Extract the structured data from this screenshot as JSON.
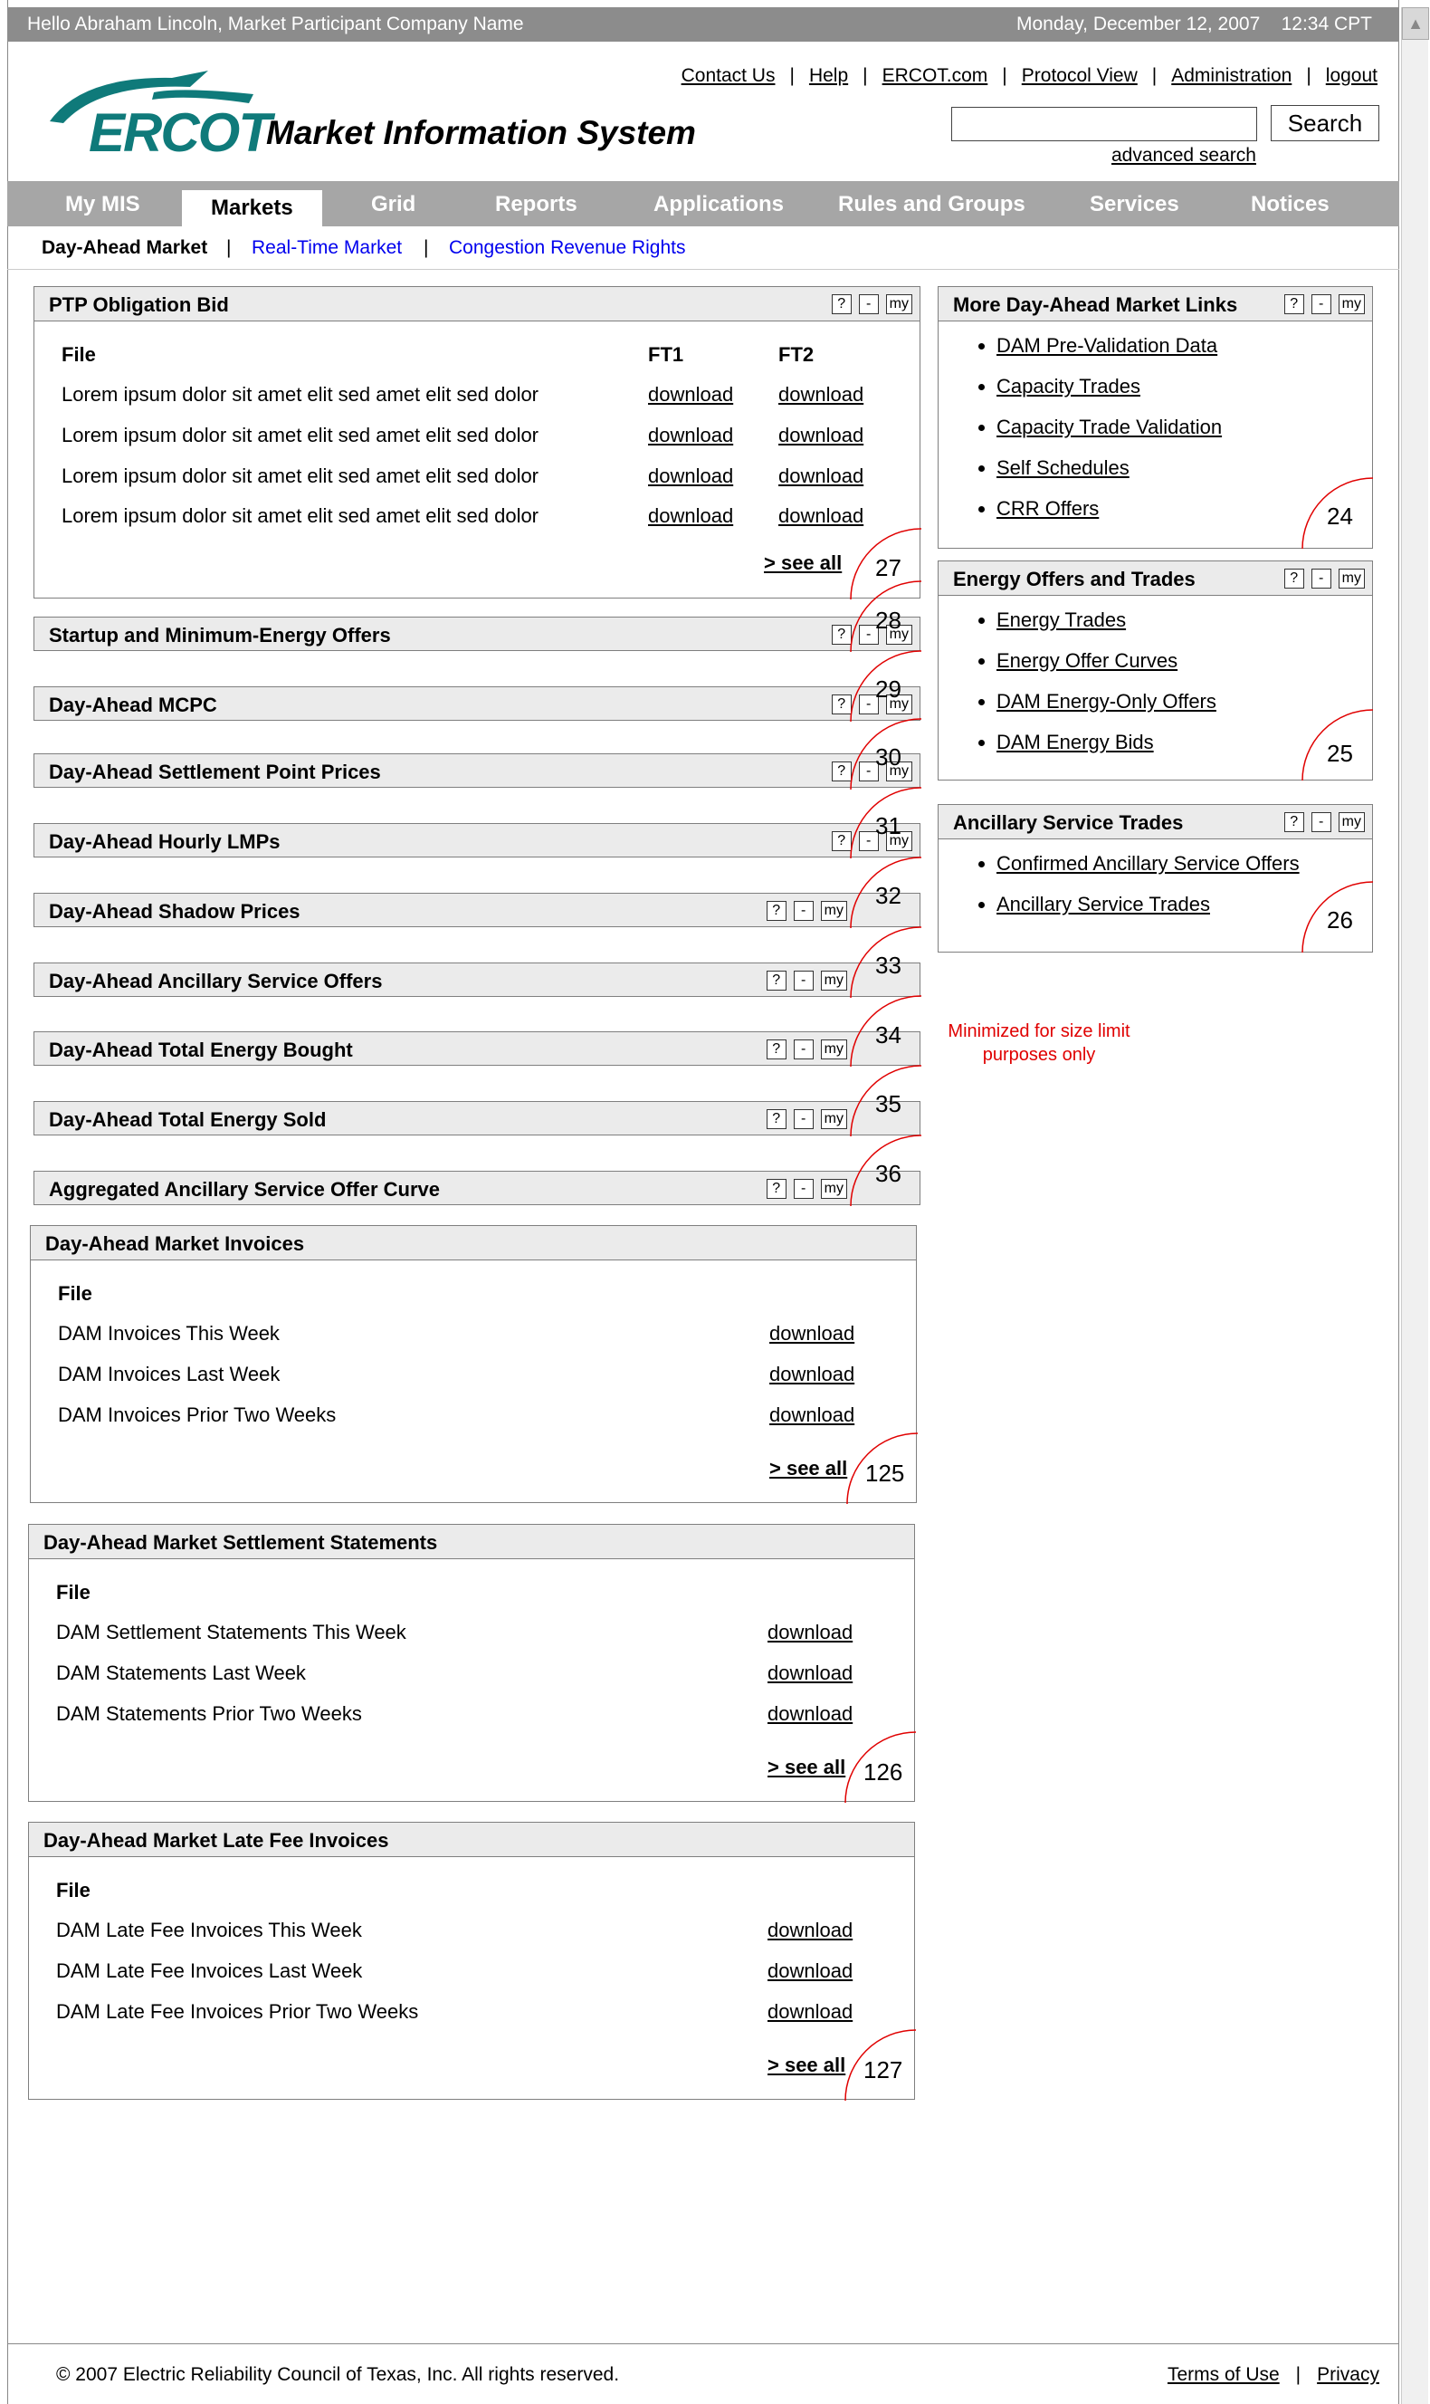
{
  "topbar": {
    "greeting": "Hello Abraham Lincoln, Market Participant Company Name",
    "datetime": "Monday, December 12, 2007    12:34 CPT"
  },
  "header": {
    "logo_text": "ERCOT",
    "title": "Market Information System",
    "links": [
      "Contact Us",
      "Help",
      "ERCOT.com",
      "Protocol View",
      "Administration",
      "logout"
    ],
    "search": {
      "value": "",
      "button": "Search",
      "advanced": "advanced search"
    }
  },
  "nav": {
    "items": [
      "My MIS",
      "Markets",
      "Grid",
      "Reports",
      "Applications",
      "Rules and Groups",
      "Services",
      "Notices"
    ],
    "active": "Markets"
  },
  "subnav": {
    "current": "Day-Ahead Market",
    "links": [
      "Real-Time Market",
      "Congestion Revenue Rights"
    ]
  },
  "controls": {
    "help": "?",
    "min": "-",
    "my": "my"
  },
  "ptp": {
    "title": "PTP Obligation Bid",
    "cols": [
      "File",
      "FT1",
      "FT2"
    ],
    "rows": [
      {
        "file": "Lorem ipsum dolor sit amet elit sed amet elit sed dolor",
        "ft1": "download",
        "ft2": "download"
      },
      {
        "file": "Lorem ipsum dolor sit amet elit sed amet elit sed dolor",
        "ft1": "download",
        "ft2": "download"
      },
      {
        "file": "Lorem ipsum dolor sit amet elit sed amet elit sed dolor",
        "ft1": "download",
        "ft2": "download"
      },
      {
        "file": "Lorem ipsum dolor sit amet elit sed amet elit sed dolor",
        "ft1": "download",
        "ft2": "download"
      }
    ],
    "see_all": "> see all",
    "callout": "27"
  },
  "collapsed": [
    {
      "title": "Startup and Minimum-Energy Offers",
      "callout": "28"
    },
    {
      "title": "Day-Ahead MCPC",
      "callout": "29"
    },
    {
      "title": "Day-Ahead Settlement Point Prices",
      "callout": "30"
    },
    {
      "title": "Day-Ahead Hourly LMPs",
      "callout": "31"
    },
    {
      "title": "Day-Ahead Shadow Prices",
      "callout": "32"
    },
    {
      "title": "Day-Ahead Ancillary Service Offers",
      "callout": "33"
    },
    {
      "title": "Day-Ahead Total Energy Bought",
      "callout": "34"
    },
    {
      "title": "Day-Ahead Total Energy Sold",
      "callout": "35"
    },
    {
      "title": "Aggregated Ancillary Service Offer Curve",
      "callout": "36"
    }
  ],
  "invoices": [
    {
      "title": "Day-Ahead Market Invoices",
      "col": "File",
      "rows": [
        {
          "file": "DAM Invoices This Week",
          "dl": "download"
        },
        {
          "file": "DAM Invoices Last Week",
          "dl": "download"
        },
        {
          "file": "DAM Invoices Prior Two Weeks",
          "dl": "download"
        }
      ],
      "see_all": "> see all",
      "callout": "125"
    },
    {
      "title": "Day-Ahead Market Settlement Statements",
      "col": "File",
      "rows": [
        {
          "file": "DAM Settlement Statements This Week",
          "dl": "download"
        },
        {
          "file": "DAM Statements Last Week",
          "dl": "download"
        },
        {
          "file": "DAM Statements Prior Two Weeks",
          "dl": "download"
        }
      ],
      "see_all": "> see all",
      "callout": "126"
    },
    {
      "title": "Day-Ahead Market Late Fee Invoices",
      "col": "File",
      "rows": [
        {
          "file": "DAM Late Fee Invoices This Week",
          "dl": "download"
        },
        {
          "file": "DAM Late Fee Invoices Last Week",
          "dl": "download"
        },
        {
          "file": "DAM Late Fee Invoices Prior Two Weeks",
          "dl": "download"
        }
      ],
      "see_all": "> see all",
      "callout": "127"
    }
  ],
  "right": [
    {
      "title": "More Day-Ahead Market Links",
      "links": [
        "DAM Pre-Validation Data",
        "Capacity Trades",
        "Capacity Trade Validation",
        "Self Schedules",
        "CRR Offers"
      ],
      "callout": "24"
    },
    {
      "title": "Energy Offers and Trades",
      "links": [
        "Energy Trades",
        "Energy Offer Curves",
        "DAM Energy-Only Offers",
        "DAM Energy Bids"
      ],
      "callout": "25"
    },
    {
      "title": "Ancillary Service Trades",
      "links": [
        "Confirmed Ancillary Service Offers",
        "Ancillary Service Trades"
      ],
      "callout": "26"
    }
  ],
  "note": "Minimized for size limit purposes only",
  "footer": {
    "copyright": "© 2007 Electric Reliability Council of Texas, Inc.  All rights reserved.",
    "links": [
      "Terms of Use",
      "Privacy"
    ]
  },
  "colors": {
    "nav_bg": "#a6a6a6",
    "panel_header": "#ebebeb",
    "logo": "#0f7a7a",
    "callout": "#e00000",
    "link_blue": "#0000ee"
  }
}
